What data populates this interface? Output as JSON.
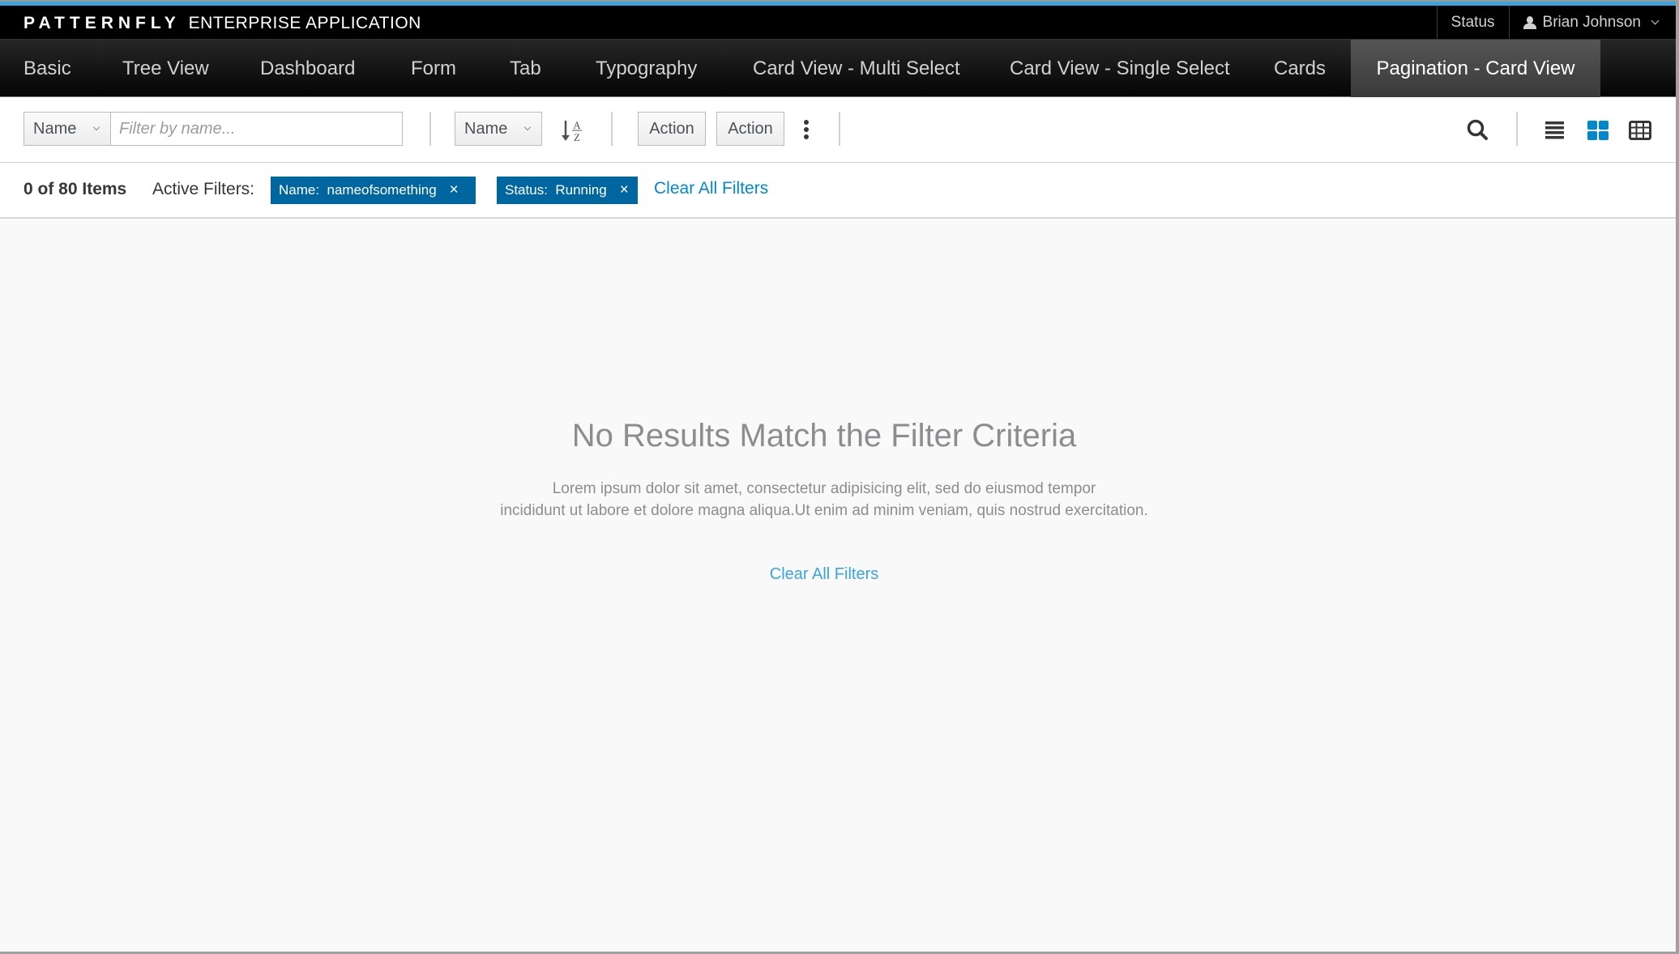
{
  "masthead": {
    "brand_logo": "PATTERNFLY",
    "brand_app": "ENTERPRISE APPLICATION",
    "status_label": "Status",
    "user_name": "Brian Johnson",
    "user_icon": "user-icon"
  },
  "nav": {
    "items": [
      {
        "label": "Basic",
        "active": false
      },
      {
        "label": "Tree View",
        "active": false
      },
      {
        "label": "Dashboard",
        "active": false
      },
      {
        "label": "Form",
        "active": false
      },
      {
        "label": "Tab",
        "active": false
      },
      {
        "label": "Typography",
        "active": false
      },
      {
        "label": "Card View - Multi Select",
        "active": false
      },
      {
        "label": "Card View - Single Select",
        "active": false
      },
      {
        "label": "Cards",
        "active": false
      },
      {
        "label": "Pagination - Card View",
        "active": true
      }
    ]
  },
  "toolbar": {
    "filter_field": "Name",
    "filter_input_value": "",
    "filter_placeholder": "Filter by name...",
    "sort_field": "Name",
    "sort_icon": "sort-alpha-asc-icon",
    "actions": [
      "Action",
      "Action"
    ],
    "more_icon": "kebab-icon",
    "search_icon": "search-icon",
    "views": [
      {
        "name": "list-view",
        "icon": "list-icon",
        "active": false
      },
      {
        "name": "card-view",
        "icon": "th-large-icon",
        "active": true
      },
      {
        "name": "table-view",
        "icon": "table-icon",
        "active": false
      }
    ],
    "active_color": "#0088ce"
  },
  "filters": {
    "count_text": "0 of 80 Items",
    "active_label": "Active Filters:",
    "chips": [
      {
        "text": "Name:  nameofsomething",
        "close": "×"
      },
      {
        "text": "Status:  Running",
        "close": "×"
      }
    ],
    "clear_label": "Clear All Filters"
  },
  "empty_state": {
    "title": "No Results Match the Filter Criteria",
    "body_line1": "Lorem ipsum dolor sit amet, consectetur adipisicing elit, sed do eiusmod tempor",
    "body_line2": "incididunt ut labore et dolore magna aliqua.Ut enim ad minim veniam, quis nostrud exercitation.",
    "action_label": "Clear All Filters"
  },
  "colors": {
    "accent_blue": "#39a5dc",
    "chip_blue": "#0066a0",
    "link_blue": "#0088ce",
    "masthead_bg": "#000000"
  }
}
